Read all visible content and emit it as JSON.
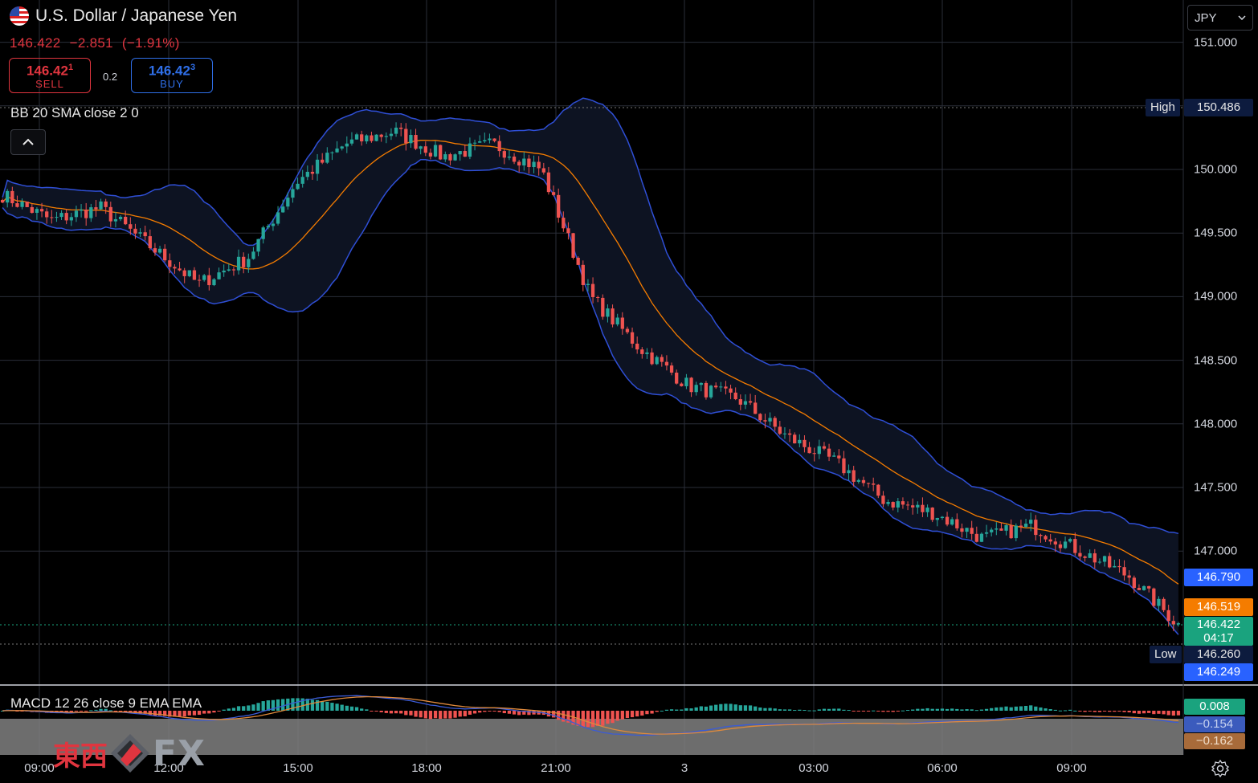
{
  "header": {
    "title": "U.S. Dollar / Japanese Yen",
    "price": "146.422",
    "change": "−2.851",
    "change_pct": "(−1.91%)"
  },
  "trade": {
    "sell_price": "146.42",
    "sell_price_sup": "1",
    "sell_label": "SELL",
    "buy_price": "146.42",
    "buy_price_sup": "3",
    "buy_label": "BUY",
    "spread": "0.2"
  },
  "indicators": {
    "bb_label": "BB 20 SMA close 2 0",
    "macd_label": "MACD 12 26 close 9 EMA EMA"
  },
  "currency": "JPY",
  "price_axis": [
    "151.000",
    "150.000",
    "149.500",
    "149.000",
    "148.500",
    "148.000",
    "147.500",
    "147.000"
  ],
  "price_labels": {
    "high_tag": "High",
    "high_value": "150.486",
    "bb_upper": "146.790",
    "bb_basis": "146.519",
    "current": "146.422",
    "countdown": "04:17",
    "low_tag": "Low",
    "low_value": "146.260",
    "bb_lower": "146.249"
  },
  "macd_labels": {
    "histogram": "0.008",
    "macd": "−0.154",
    "signal": "−0.162"
  },
  "time_axis": [
    "09:00",
    "12:00",
    "15:00",
    "18:00",
    "21:00",
    "3",
    "03:00",
    "06:00",
    "09:00"
  ],
  "logo": {
    "kanji": "東西",
    "fx": "FX"
  },
  "colors": {
    "up": "#26a69a",
    "down": "#ef5350",
    "bb_band": "#2f4fd6",
    "bb_basis": "#f57c00",
    "sell": "#e0353f",
    "buy": "#2f6fe8"
  },
  "chart_data": {
    "type": "candlestick",
    "ylim": [
      146.249,
      151.0
    ],
    "series": [
      {
        "name": "BB 20 SMA close 2 0",
        "values": [
          149.8,
          149.6,
          149.7,
          149.4,
          149.1,
          149.3,
          149.9,
          150.2,
          150.3,
          150.1,
          150.2,
          150.0,
          149.0,
          148.6,
          148.3,
          148.2,
          147.9,
          147.7,
          147.4,
          147.3,
          147.1,
          147.2,
          147.0,
          146.8,
          146.42
        ]
      }
    ],
    "high": 150.486,
    "low": 146.26,
    "last": 146.422
  }
}
